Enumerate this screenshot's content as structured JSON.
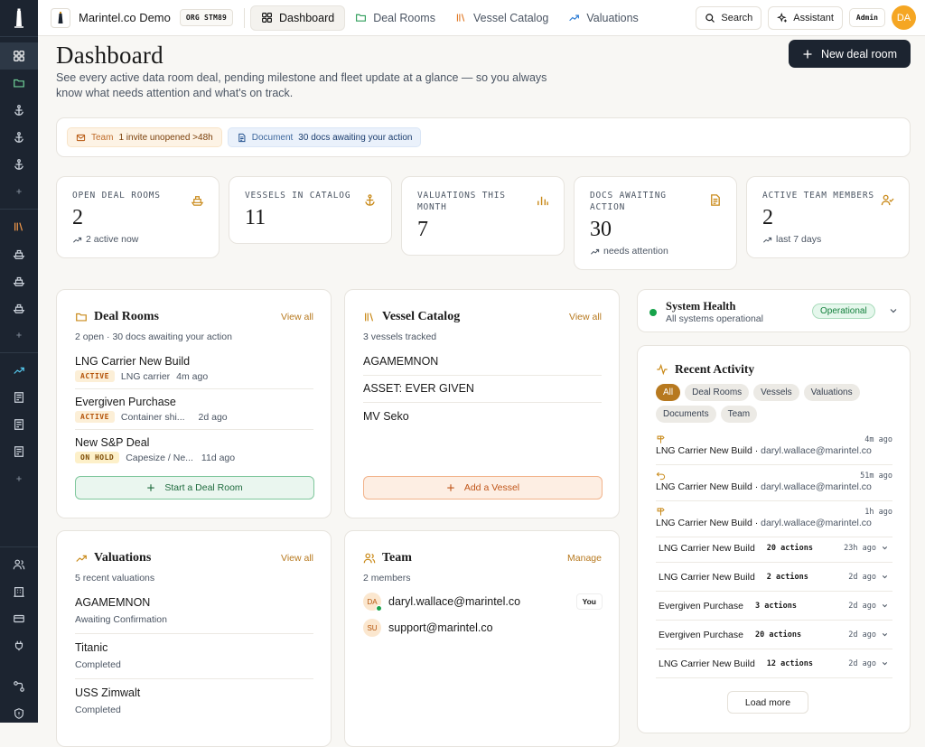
{
  "app": {
    "name": "Marintel.co Demo",
    "org": "ORG STM89",
    "user_initials": "DA",
    "user_role": "Admin"
  },
  "nav": {
    "tabs": [
      {
        "label": "Dashboard",
        "icon": "grid-icon",
        "active": true
      },
      {
        "label": "Deal Rooms",
        "icon": "folder-icon",
        "active": false
      },
      {
        "label": "Vessel Catalog",
        "icon": "library-icon",
        "active": false
      },
      {
        "label": "Valuations",
        "icon": "trend-icon",
        "active": false
      }
    ],
    "search_label": "Search",
    "assistant_label": "Assistant"
  },
  "page": {
    "title": "Dashboard",
    "subtitle": "See every active data room deal, pending milestone and fleet update at a glance — so you always know what needs attention and what's on track.",
    "new_button": "New deal room"
  },
  "alerts": [
    {
      "kind": "Team",
      "text": "1 invite unopened >48h"
    },
    {
      "kind": "Document",
      "text": "30 docs awaiting your action"
    }
  ],
  "stats": [
    {
      "label": "OPEN DEAL ROOMS",
      "value": "2",
      "trend": "2 active now",
      "icon": "ship-icon"
    },
    {
      "label": "VESSELS IN CATALOG",
      "value": "11",
      "trend": "",
      "icon": "anchor-icon"
    },
    {
      "label": "VALUATIONS THIS MONTH",
      "value": "7",
      "trend": "",
      "icon": "bar-chart-icon"
    },
    {
      "label": "DOCS AWAITING ACTION",
      "value": "30",
      "trend": "needs attention",
      "icon": "document-icon"
    },
    {
      "label": "ACTIVE TEAM MEMBERS",
      "value": "2",
      "trend": "last 7 days",
      "icon": "user-check-icon"
    }
  ],
  "deal_rooms": {
    "title": "Deal Rooms",
    "view_all": "View all",
    "meta": "2 open · 30 docs awaiting your action",
    "items": [
      {
        "name": "LNG Carrier New Build",
        "status": "ACTIVE",
        "type": "LNG carrier",
        "time": "4m ago"
      },
      {
        "name": "Evergiven Purchase",
        "status": "ACTIVE",
        "type": "Container shi...",
        "time": "2d ago"
      },
      {
        "name": "New S&P Deal",
        "status": "ON HOLD",
        "type": "Capesize / Ne...",
        "time": "11d ago"
      }
    ],
    "cta": "Start a Deal Room"
  },
  "vessel_catalog": {
    "title": "Vessel Catalog",
    "view_all": "View all",
    "meta": "3 vessels tracked",
    "items": [
      "AGAMEMNON",
      "ASSET: EVER GIVEN",
      "MV Seko"
    ],
    "cta": "Add a Vessel"
  },
  "valuations": {
    "title": "Valuations",
    "view_all": "View all",
    "meta": "5 recent valuations",
    "items": [
      {
        "name": "AGAMEMNON",
        "status": "Awaiting Confirmation"
      },
      {
        "name": "Titanic",
        "status": "Completed"
      },
      {
        "name": "USS Zimwalt",
        "status": "Completed"
      }
    ]
  },
  "team": {
    "title": "Team",
    "manage": "Manage",
    "meta": "2 members",
    "members": [
      {
        "initials": "DA",
        "email": "daryl.wallace@marintel.co",
        "badge": "You"
      },
      {
        "initials": "SU",
        "email": "support@marintel.co",
        "badge": ""
      }
    ]
  },
  "system_health": {
    "title": "System Health",
    "subtitle": "All systems operational",
    "status": "Operational"
  },
  "activity": {
    "title": "Recent Activity",
    "filters": [
      "All",
      "Deal Rooms",
      "Vessels",
      "Valuations",
      "Documents",
      "Team"
    ],
    "events": [
      {
        "time": "4m ago",
        "deal": "LNG Carrier New Build",
        "user": "daryl.wallace@marintel.co",
        "icon": "signpost-icon"
      },
      {
        "time": "51m ago",
        "deal": "LNG Carrier New Build",
        "user": "daryl.wallace@marintel.co",
        "icon": "undo-icon"
      },
      {
        "time": "1h ago",
        "deal": "LNG Carrier New Build",
        "user": "daryl.wallace@marintel.co",
        "icon": "signpost-icon"
      }
    ],
    "groups": [
      {
        "deal": "LNG Carrier New Build",
        "count": "20 actions",
        "time": "23h ago"
      },
      {
        "deal": "LNG Carrier New Build",
        "count": "2 actions",
        "time": "2d ago"
      },
      {
        "deal": "Evergiven Purchase",
        "count": "3 actions",
        "time": "2d ago"
      },
      {
        "deal": "Evergiven Purchase",
        "count": "20 actions",
        "time": "2d ago"
      },
      {
        "deal": "LNG Carrier New Build",
        "count": "12 actions",
        "time": "2d ago"
      }
    ],
    "load_more": "Load more"
  },
  "colors": {
    "accent": "#b7791f",
    "sidebar": "#1c2430",
    "primary_button": "#1c2430",
    "success": "#16a34a",
    "avatar": "#f5a623"
  }
}
